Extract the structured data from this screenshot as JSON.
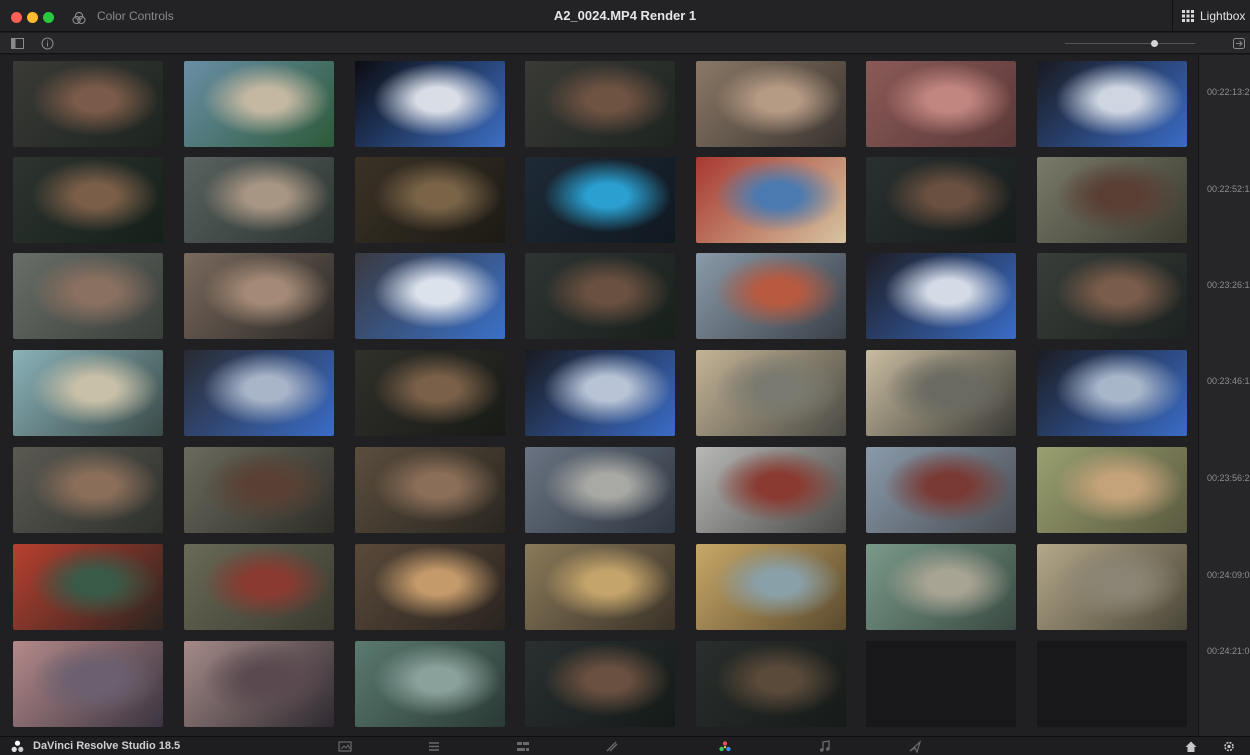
{
  "titlebar": {
    "panel_label": "Color Controls",
    "window_title": "A2_0024.MP4 Render 1",
    "lightbox_label": "Lightbox"
  },
  "toolbar": {
    "icons": [
      "sidebar-toggle-icon",
      "info-icon",
      "exit-lightbox-icon"
    ],
    "zoom_level": 0.66
  },
  "timecodes": [
    "00:22:13:2",
    "00:22:52:1",
    "00:23:26:1",
    "00:23:46:1",
    "00:23:56:2",
    "00:24:09:0",
    "00:24:21:0"
  ],
  "bottombar": {
    "brand": "DaVinci Resolve Studio 18.5",
    "pages": [
      "media-page-icon",
      "cut-page-icon",
      "edit-page-icon",
      "fusion-page-icon",
      "color-page-icon",
      "fairlight-page-icon",
      "deliver-page-icon"
    ],
    "active_page": "color-page-icon",
    "right_icons": [
      "home-icon",
      "settings-icon"
    ]
  },
  "clips": [
    {
      "desc": "man-glasses-xmas-tree",
      "colors": [
        "#3a3a36",
        "#7a5a48",
        "#1d2420"
      ]
    },
    {
      "desc": "woman-video-call",
      "colors": [
        "#6a8fa6",
        "#c4b8a2",
        "#2d5a3a"
      ]
    },
    {
      "desc": "phone-chat-screen",
      "colors": [
        "#0c0c10",
        "#d9dde6",
        "#3d6fc4"
      ]
    },
    {
      "desc": "man-glasses-xmas-tree",
      "colors": [
        "#3a3a36",
        "#6e5242",
        "#1d2420"
      ]
    },
    {
      "desc": "hands-holding-phone",
      "colors": [
        "#8a7866",
        "#b59a84",
        "#3a3430"
      ]
    },
    {
      "desc": "blurry-skin-closeup",
      "colors": [
        "#8a5a58",
        "#c28680",
        "#5a3838"
      ]
    },
    {
      "desc": "phone-chat-screen",
      "colors": [
        "#1a1a20",
        "#cfd6e2",
        "#3a6cc6"
      ]
    },
    {
      "desc": "man-phone-xmas-tree",
      "colors": [
        "#2e3430",
        "#7a5e48",
        "#15201a"
      ]
    },
    {
      "desc": "man-glasses-office",
      "colors": [
        "#5a6260",
        "#a89684",
        "#2c3532"
      ]
    },
    {
      "desc": "office-room-wide",
      "colors": [
        "#3a3226",
        "#7a6448",
        "#1c1a14"
      ]
    },
    {
      "desc": "desktop-folders-screen",
      "colors": [
        "#1e2a36",
        "#2a9fd0",
        "#101820"
      ]
    },
    {
      "desc": "graffiti-man-blur",
      "colors": [
        "#a83830",
        "#4a7ab0",
        "#d6c4a0"
      ]
    },
    {
      "desc": "man-glasses-xmas-tree",
      "colors": [
        "#2a3030",
        "#6a5040",
        "#161c1a"
      ]
    },
    {
      "desc": "woman-closeup-office",
      "colors": [
        "#7a7a6a",
        "#5a3e34",
        "#3a3a30"
      ]
    },
    {
      "desc": "man-closeup-office",
      "colors": [
        "#6a6e68",
        "#8a7060",
        "#3a3e3a"
      ]
    },
    {
      "desc": "hands-phone-closeup",
      "colors": [
        "#7a6a5e",
        "#a48a76",
        "#2a2826"
      ]
    },
    {
      "desc": "phone-chat-screen",
      "colors": [
        "#3a3a40",
        "#dce2ec",
        "#3a70c8"
      ]
    },
    {
      "desc": "man-glasses-xmas-tree",
      "colors": [
        "#2e3432",
        "#6a5040",
        "#18201c"
      ]
    },
    {
      "desc": "woman-river-street",
      "colors": [
        "#8a9aa8",
        "#b85a40",
        "#3a4048"
      ]
    },
    {
      "desc": "phone-chat-screen",
      "colors": [
        "#1e1e24",
        "#d4dae6",
        "#3a6cc6"
      ]
    },
    {
      "desc": "man-glasses-closeup",
      "colors": [
        "#3a3e3a",
        "#7a5c4a",
        "#1c2220"
      ]
    },
    {
      "desc": "woman-stretching-window",
      "colors": [
        "#8ab2b8",
        "#c8c0a8",
        "#3a4a48"
      ]
    },
    {
      "desc": "phone-chat-screen",
      "colors": [
        "#2a2a30",
        "#a8b4c8",
        "#3a6cc6"
      ]
    },
    {
      "desc": "man-phone-xmas-tree",
      "colors": [
        "#30302a",
        "#7a6048",
        "#181a16"
      ]
    },
    {
      "desc": "phone-chat-screen",
      "colors": [
        "#1a1a20",
        "#b8c4d6",
        "#3a6cc6"
      ]
    },
    {
      "desc": "woman-riverside-city",
      "colors": [
        "#c4b496",
        "#7a7a70",
        "#4a4a44"
      ]
    },
    {
      "desc": "couple-riverside-city",
      "colors": [
        "#c8bca0",
        "#6a6a62",
        "#3a3a36"
      ]
    },
    {
      "desc": "phone-chat-screen",
      "colors": [
        "#1c1c22",
        "#a8b6ca",
        "#3a6cc6"
      ]
    },
    {
      "desc": "man-office-closeup",
      "colors": [
        "#5a5a52",
        "#8a6e5a",
        "#2e302c"
      ]
    },
    {
      "desc": "woman-portrait-office",
      "colors": [
        "#6a6a5e",
        "#5a4034",
        "#2e2e28"
      ]
    },
    {
      "desc": "couple-sofa-indoor",
      "colors": [
        "#5a4e3e",
        "#8a6e58",
        "#2a2620"
      ]
    },
    {
      "desc": "city-street-buildings",
      "colors": [
        "#6a7482",
        "#a8a8a4",
        "#2e3640"
      ]
    },
    {
      "desc": "woman-tilted-street",
      "colors": [
        "#b8b8b6",
        "#8a3a30",
        "#4a4a48"
      ]
    },
    {
      "desc": "woman-market-street",
      "colors": [
        "#8a9aaa",
        "#7a3a34",
        "#4a4e54"
      ]
    },
    {
      "desc": "couple-street-vendors",
      "colors": [
        "#9aa070",
        "#c4a27a",
        "#5a5a40"
      ]
    },
    {
      "desc": "shrine-people-street",
      "colors": [
        "#b84030",
        "#3a5a48",
        "#2a2420"
      ]
    },
    {
      "desc": "couple-street-shop",
      "colors": [
        "#6a6a58",
        "#8a3a30",
        "#3a3a30"
      ]
    },
    {
      "desc": "woman-sunset-portrait",
      "colors": [
        "#5a4a3a",
        "#c49a6a",
        "#2a2420"
      ]
    },
    {
      "desc": "man-sunlit-portrait",
      "colors": [
        "#8a7a5a",
        "#c4a46a",
        "#3a3228"
      ]
    },
    {
      "desc": "couple-riverside-pier",
      "colors": [
        "#c8a868",
        "#8aa0a8",
        "#5a4a2e"
      ]
    },
    {
      "desc": "man-white-shirt-river",
      "colors": [
        "#7a9a8a",
        "#a8a494",
        "#3a4a42"
      ]
    },
    {
      "desc": "man-street-wide",
      "colors": [
        "#b4a88a",
        "#8a8474",
        "#4a4638"
      ]
    },
    {
      "desc": "riverside-dusk-crowd",
      "colors": [
        "#b48a8a",
        "#6a6070",
        "#3a3440"
      ]
    },
    {
      "desc": "dusk-railing-people",
      "colors": [
        "#a48a88",
        "#5a4a50",
        "#2e2a30"
      ]
    },
    {
      "desc": "office-desk-window",
      "colors": [
        "#5a7a70",
        "#8aa09a",
        "#2a3a34"
      ]
    },
    {
      "desc": "man-glasses-xmas-tree",
      "colors": [
        "#2a3030",
        "#6a5040",
        "#141a18"
      ]
    },
    {
      "desc": "xmas-tree-desk",
      "colors": [
        "#2a2e2c",
        "#5a4a3a",
        "#161a18"
      ]
    }
  ]
}
